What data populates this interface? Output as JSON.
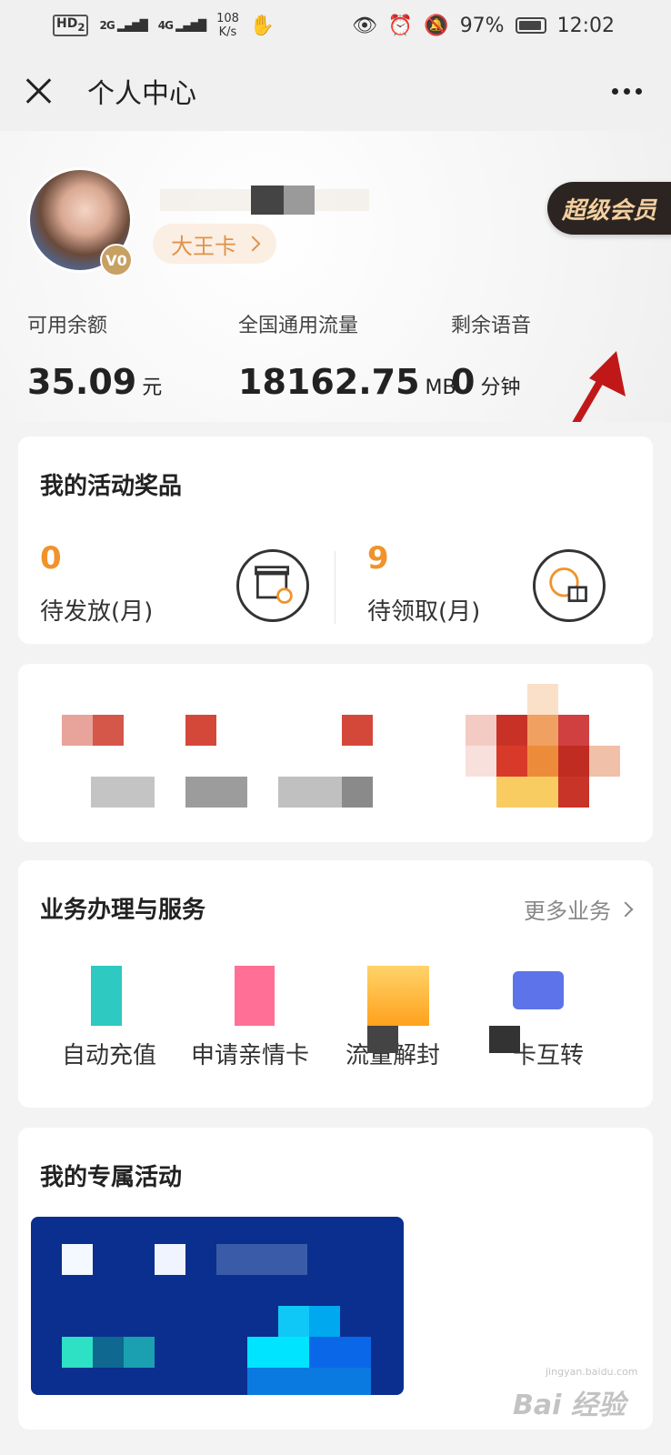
{
  "status_bar": {
    "network_hd": "HD",
    "network_hd_sub": "2",
    "signal1": "2G",
    "signal2": "4G",
    "speed_value": "108",
    "speed_unit": "K/s",
    "battery": "97%",
    "time": "12:02"
  },
  "nav": {
    "title": "个人中心"
  },
  "profile": {
    "vip_level": "V0",
    "card_name": "大王卡",
    "super_vip": "超级会员",
    "stats": [
      {
        "label": "可用余额",
        "value": "35.09",
        "unit": "元"
      },
      {
        "label": "全国通用流量",
        "value": "18162.75",
        "unit": "MB"
      },
      {
        "label": "剩余语音",
        "value": "0",
        "unit": "分钟"
      }
    ]
  },
  "prizes": {
    "title": "我的活动奖品",
    "items": [
      {
        "count": "0",
        "label": "待发放(月)"
      },
      {
        "count": "9",
        "label": "待领取(月)"
      }
    ]
  },
  "services": {
    "title": "业务办理与服务",
    "more": "更多业务",
    "items": [
      {
        "label": "自动充值",
        "color": "#2ec9c0"
      },
      {
        "label": "申请亲情卡",
        "color": "#ff6f96"
      },
      {
        "label": "流量解封",
        "color": "#ffa11d"
      },
      {
        "label": "卡互转",
        "color": "#5c73ea"
      }
    ]
  },
  "exclusive": {
    "title": "我的专属活动"
  },
  "watermark": {
    "text": "Bai 经验",
    "sub": "jingyan.baidu.com"
  },
  "colors": {
    "accent_orange": "#f0932a",
    "super_vip_text": "#f3cfa0",
    "arrow_red": "#c01818"
  }
}
